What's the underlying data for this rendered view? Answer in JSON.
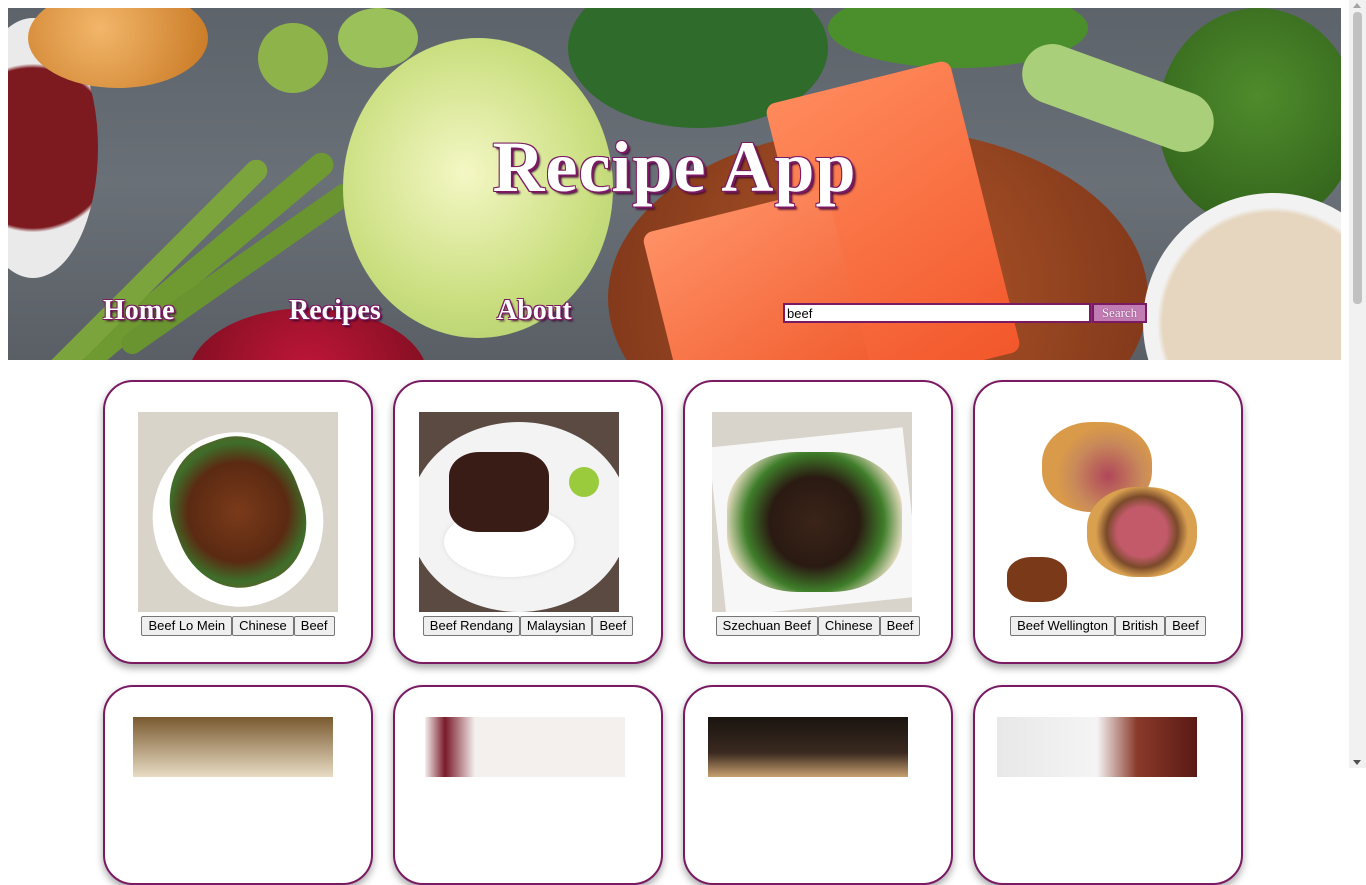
{
  "header": {
    "title": "Recipe App",
    "nav": {
      "home": "Home",
      "recipes": "Recipes",
      "about": "About"
    },
    "search": {
      "value": "beef",
      "button_label": "Search"
    }
  },
  "recipes": [
    {
      "name": "Beef Lo Mein",
      "area": "Chinese",
      "category": "Beef"
    },
    {
      "name": "Beef Rendang",
      "area": "Malaysian",
      "category": "Beef"
    },
    {
      "name": "Szechuan Beef",
      "area": "Chinese",
      "category": "Beef"
    },
    {
      "name": "Beef Wellington",
      "area": "British",
      "category": "Beef"
    }
  ],
  "colors": {
    "accent": "#7a1a63",
    "search_button": "#c27cb4"
  }
}
